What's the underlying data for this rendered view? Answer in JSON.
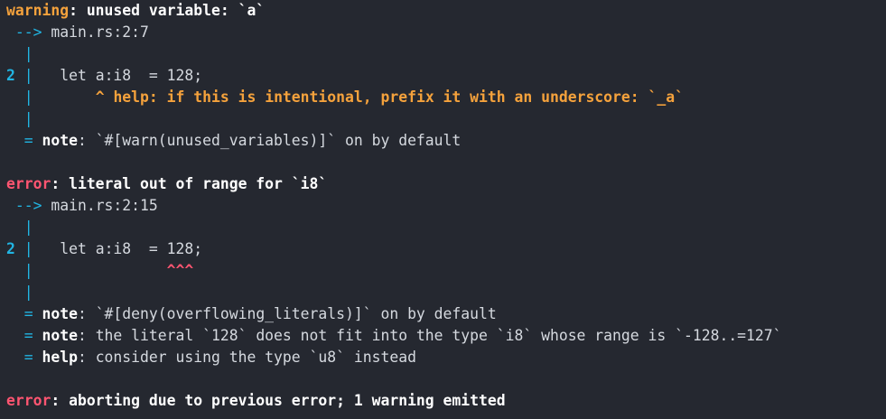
{
  "colors": {
    "background": "#252830",
    "warning": "#f5a23c",
    "error": "#ff5571",
    "gutter": "#21b5e3",
    "text": "#d5d9df"
  },
  "warning_block": {
    "level": "warning",
    "message": ": unused variable: `a`",
    "location_arrow": " -->",
    "location": " main.rs:2:7",
    "gutter_blank": "  |",
    "line_number": "2",
    "gutter_pipe": " |",
    "source_line": "   let a:i8  = 128;",
    "gutter_indent": "  ",
    "pipe": "|",
    "help_indent": "       ",
    "help_text": "^ help: if this is intentional, prefix it with an underscore: `_a`",
    "note_eq": "  =",
    "note_label": " note",
    "note_text": ": `#[warn(unused_variables)]` on by default"
  },
  "error_block_1": {
    "level": "error",
    "message": ": literal out of range for `i8`",
    "location_arrow": " -->",
    "location": " main.rs:2:15",
    "gutter_blank": "  |",
    "line_number": "2",
    "gutter_pipe": " |",
    "source_line": "   let a:i8  = 128;",
    "gutter_indent": "  ",
    "pipe": "|",
    "caret_indent": "               ",
    "carets": "^^^",
    "notes": [
      {
        "eq": "  =",
        "label": " note",
        "text": ": `#[deny(overflowing_literals)]` on by default"
      },
      {
        "eq": "  =",
        "label": " note",
        "text": ": the literal `128` does not fit into the type `i8` whose range is `-128..=127`"
      },
      {
        "eq": "  =",
        "label": " help",
        "text": ": consider using the type `u8` instead"
      }
    ]
  },
  "error_block_2": {
    "level": "error",
    "message": ": aborting due to previous error; 1 warning emitted"
  }
}
